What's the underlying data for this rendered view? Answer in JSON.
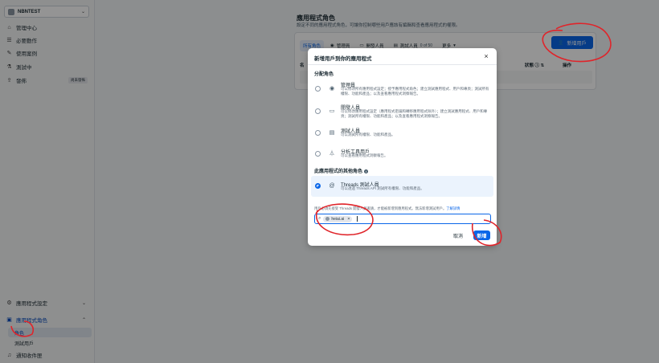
{
  "sidebar": {
    "app_name": "NBNTEST",
    "items": [
      {
        "label": "管理中心",
        "icon": "home-icon"
      },
      {
        "label": "必要動作",
        "icon": "list-icon"
      },
      {
        "label": "使用案例",
        "icon": "pencil-icon"
      },
      {
        "label": "測試中",
        "icon": "flask-icon"
      },
      {
        "label": "發佈",
        "icon": "upload-icon",
        "badge": "尚未發佈"
      }
    ],
    "bottom": [
      {
        "label": "應用程式設定",
        "icon": "gear-icon"
      },
      {
        "label": "應用程式角色",
        "icon": "user-roles-icon"
      }
    ],
    "sub_items": [
      {
        "label": "角色"
      },
      {
        "label": "測試用戶"
      }
    ],
    "notification": {
      "label": "通知收件匣",
      "icon": "bell-icon"
    }
  },
  "main": {
    "title": "應用程式角色",
    "description": "設定不同的應用程式角色，可讓你控制哪些用戶應該有編輯和查看應用程式的權限。",
    "tabs": [
      {
        "label": "所有角色"
      },
      {
        "label": "管理員"
      },
      {
        "label": "開發人員"
      },
      {
        "label": "測試人員",
        "count": "0 of 50"
      },
      {
        "label": "更多"
      }
    ],
    "add_user_label": "新增用戶",
    "table": {
      "status": "狀態",
      "actions": "操作",
      "partial": "名"
    }
  },
  "modal": {
    "title": "新增用戶到你的應用程式",
    "assign_role": "分配角色",
    "roles": [
      {
        "name": "管理員",
        "desc": "可以修改所有應用程式設定；授予應用程式角色；建立測試應用程式、用戶和專頁；測試所有權限、功能和產品；以及查看應用程式洞察報告。",
        "icon": "target-icon"
      },
      {
        "name": "開發人員",
        "desc": "可以修改應用程式設定（應用程式密鑰和轉移應用程式除外）；建立測試應用程式、用戶和專頁；測試所有權限、功能和產品；以及查看應用程式洞察報告。",
        "icon": "laptop-icon"
      },
      {
        "name": "測試人員",
        "desc": "可以測試所有權限、功能和產品。",
        "icon": "clipboard-icon"
      },
      {
        "name": "分析工具用戶",
        "desc": "可以查看應用程式洞察報告。",
        "icon": "filter-icon"
      }
    ],
    "other_roles": "此應用程式的其他角色",
    "threads": {
      "name": "Threads 測試人員",
      "desc": "可以透過 Threads API 測試所有權限、功能和產品。",
      "icon": "threads-icon"
    },
    "hint": "用戶必須先接受 Threads 開發人員邀請，才能被新增到應用程式。無法新增測試用戶。",
    "hint_link": "了解詳情",
    "chip": "heiai.ai",
    "cancel": "取消",
    "add": "新增"
  }
}
